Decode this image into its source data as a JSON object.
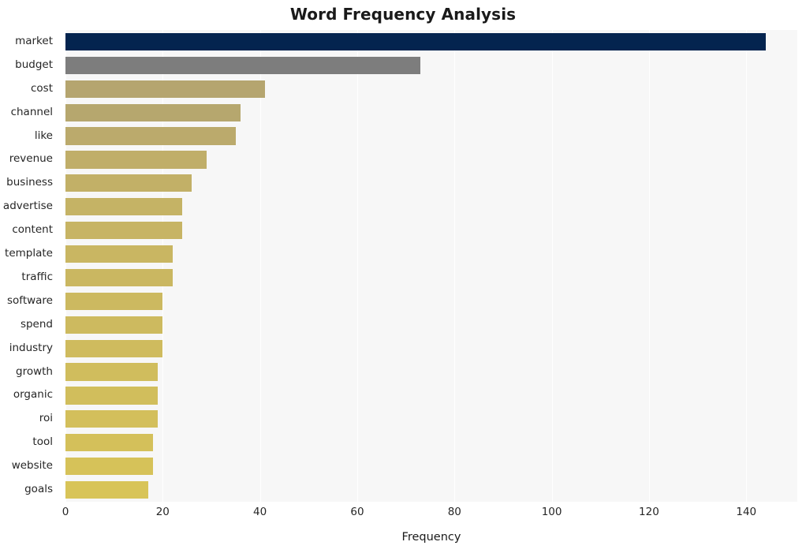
{
  "chart_data": {
    "type": "bar",
    "orientation": "horizontal",
    "title": "Word Frequency Analysis",
    "xlabel": "Frequency",
    "ylabel": "",
    "xlim": [
      0,
      150.5
    ],
    "ylim": [
      0,
      20
    ],
    "grid": true,
    "gridlines": "vertical-white",
    "legend": null,
    "xticks": [
      "0",
      "20",
      "40",
      "60",
      "80",
      "100",
      "120",
      "140"
    ],
    "xtick_values": [
      0,
      20,
      40,
      60,
      80,
      100,
      120,
      140
    ],
    "categories": [
      "market",
      "budget",
      "cost",
      "channel",
      "like",
      "revenue",
      "business",
      "advertise",
      "content",
      "template",
      "traffic",
      "software",
      "spend",
      "industry",
      "growth",
      "organic",
      "roi",
      "tool",
      "website",
      "goals"
    ],
    "values": [
      144,
      73,
      41,
      36,
      35,
      29,
      26,
      24,
      24,
      22,
      22,
      20,
      20,
      20,
      19,
      19,
      19,
      18,
      18,
      17
    ],
    "bar_colors": [
      "#04244f",
      "#7d7d7d",
      "#b5a56f",
      "#b6a76e",
      "#bbaa6c",
      "#c0ae69",
      "#c2b067",
      "#c5b365",
      "#c7b464",
      "#c9b662",
      "#cab761",
      "#ccb960",
      "#cdba5f",
      "#cfbb5e",
      "#d0bd5d",
      "#d1be5c",
      "#d3bf5b",
      "#d4c05a",
      "#d6c259",
      "#d8c458"
    ],
    "plot_background": "#f7f7f7",
    "figure_background": "#ffffff",
    "text_color": "#262626"
  },
  "icons": {
    "chart_icon": "bar-chart-icon"
  }
}
